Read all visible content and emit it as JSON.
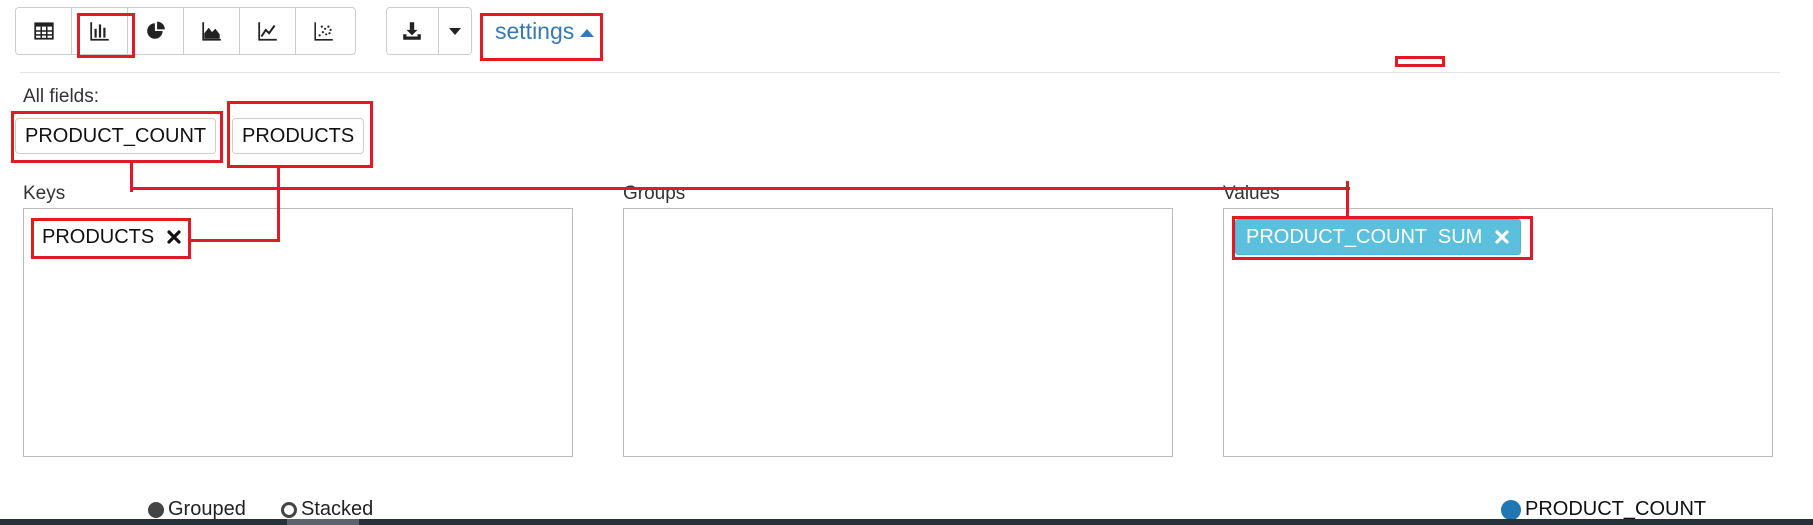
{
  "toolbar": {
    "view_buttons": [
      {
        "name": "table-view-button",
        "icon": "table-icon"
      },
      {
        "name": "bar-chart-view-button",
        "icon": "bar-chart-icon"
      },
      {
        "name": "pie-chart-view-button",
        "icon": "pie-chart-icon"
      },
      {
        "name": "area-chart-view-button",
        "icon": "area-chart-icon"
      },
      {
        "name": "line-chart-view-button",
        "icon": "line-chart-icon"
      },
      {
        "name": "scatter-chart-view-button",
        "icon": "scatter-chart-icon"
      }
    ],
    "download_icon": "download-icon",
    "dropdown_icon": "caret-down-icon",
    "settings_label": "settings"
  },
  "fields": {
    "label": "All fields:",
    "items": [
      "PRODUCT_COUNT",
      "PRODUCTS"
    ]
  },
  "keys": {
    "label": "Keys",
    "items": [
      "PRODUCTS"
    ]
  },
  "groups": {
    "label": "Groups",
    "items": []
  },
  "values": {
    "label": "Values",
    "items": [
      {
        "field": "PRODUCT_COUNT",
        "agg": "SUM",
        "text": "PRODUCT_COUNT  SUM"
      }
    ]
  },
  "chart_mode": {
    "options": [
      "Grouped",
      "Stacked"
    ],
    "selected": "Grouped"
  },
  "legend": {
    "series": "PRODUCT_COUNT",
    "color": "#1f77b4"
  },
  "colors": {
    "accent": "#337ab7",
    "value_chip": "#5bc0de",
    "annotation": "#e01b24"
  }
}
